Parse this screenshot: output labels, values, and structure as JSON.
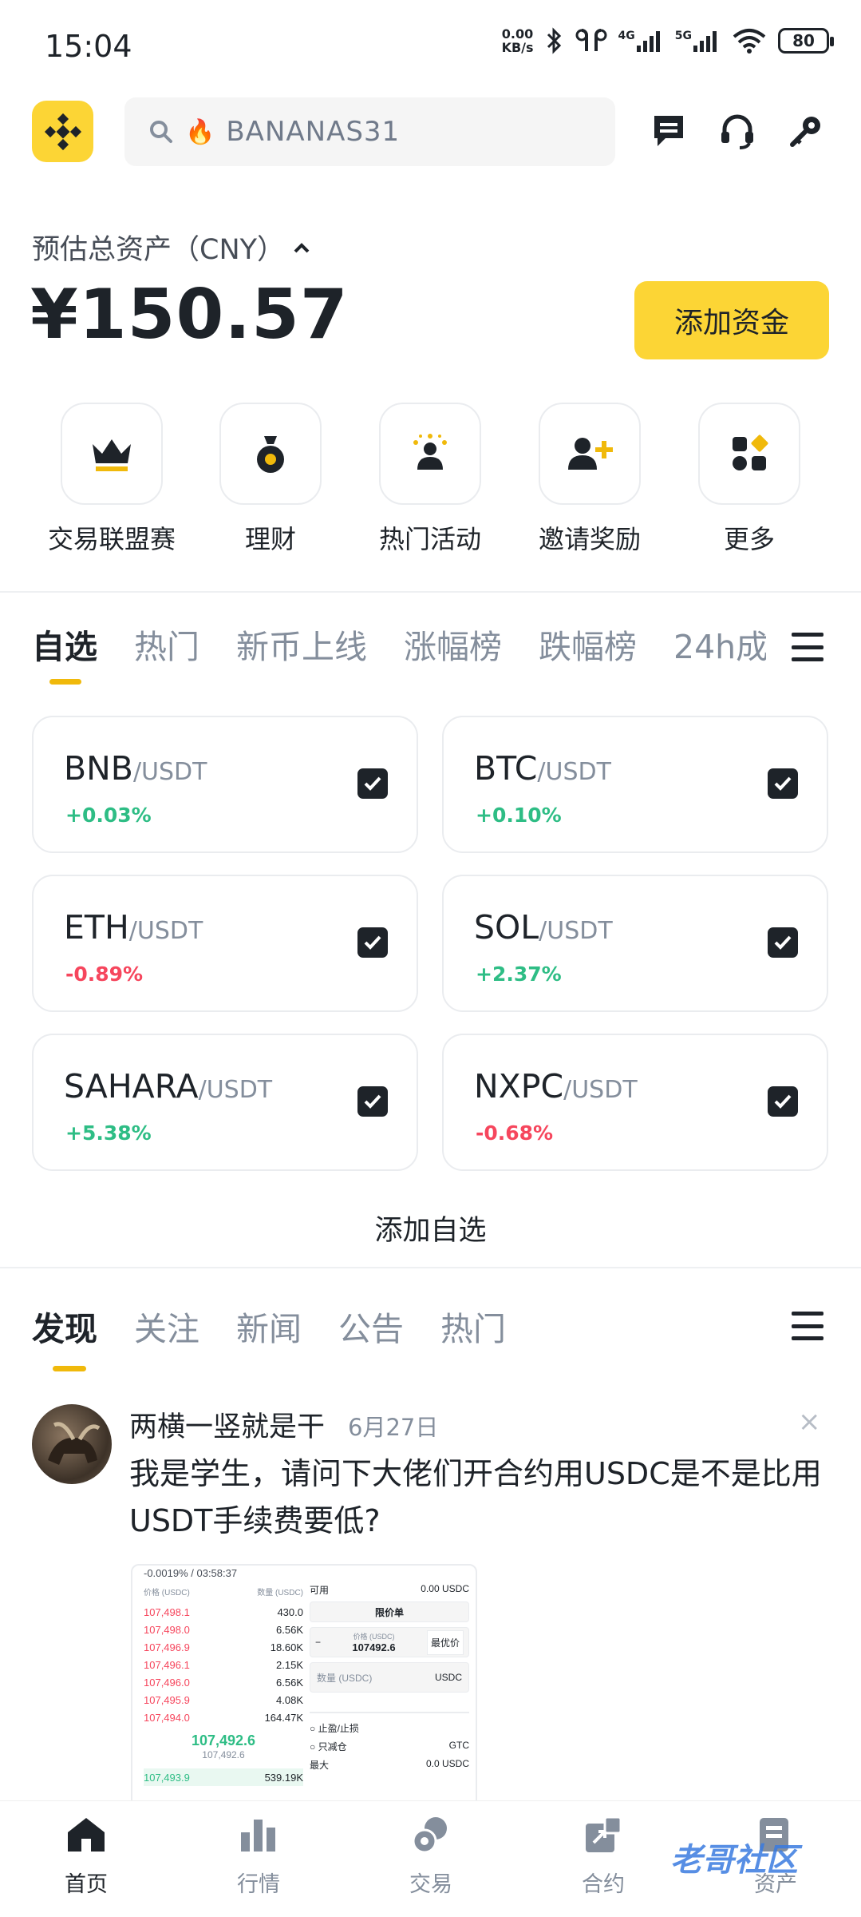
{
  "status_bar": {
    "time": "15:04",
    "net_speed": "0.00",
    "net_unit": "KB/s",
    "signal_1": "4G",
    "signal_2": "5G",
    "battery": "80"
  },
  "header": {
    "search_placeholder": "BANANAS31",
    "search_emoji": "🔥"
  },
  "assets": {
    "label": "预估总资产（CNY）",
    "value": "¥150.57",
    "add_funds": "添加资金"
  },
  "quick_actions": [
    {
      "label": "交易联盟赛",
      "icon": "crown-icon"
    },
    {
      "label": "理财",
      "icon": "money-bag-icon"
    },
    {
      "label": "热门活动",
      "icon": "celebration-icon"
    },
    {
      "label": "邀请奖励",
      "icon": "add-user-icon"
    },
    {
      "label": "更多",
      "icon": "grid-more-icon"
    }
  ],
  "watch_tabs": [
    "自选",
    "热门",
    "新币上线",
    "涨幅榜",
    "跌幅榜",
    "24h成"
  ],
  "watchlist": [
    {
      "base": "BNB",
      "quote": "/USDT",
      "change": "+0.03%",
      "dir": "up"
    },
    {
      "base": "BTC",
      "quote": "/USDT",
      "change": "+0.10%",
      "dir": "up"
    },
    {
      "base": "ETH",
      "quote": "/USDT",
      "change": "-0.89%",
      "dir": "down"
    },
    {
      "base": "SOL",
      "quote": "/USDT",
      "change": "+2.37%",
      "dir": "up"
    },
    {
      "base": "SAHARA",
      "quote": "/USDT",
      "change": "+5.38%",
      "dir": "up"
    },
    {
      "base": "NXPC",
      "quote": "/USDT",
      "change": "-0.68%",
      "dir": "down"
    }
  ],
  "add_watch": "添加自选",
  "feed_tabs": [
    "发现",
    "关注",
    "新闻",
    "公告",
    "热门"
  ],
  "post": {
    "user": "两横一竖就是干",
    "date": "6月27日",
    "close": "×",
    "text": "我是学生，请问下大佬们开合约用USDC是不是比用USDT手续费要低?",
    "embed": {
      "header": "-0.0019% / 03:58:37",
      "col_price": "价格 (USDC)",
      "col_qty": "数量 (USDC)",
      "asks": [
        {
          "price": "107,498.1",
          "qty": "430.0"
        },
        {
          "price": "107,498.0",
          "qty": "6.56K"
        },
        {
          "price": "107,496.9",
          "qty": "18.60K"
        },
        {
          "price": "107,496.1",
          "qty": "2.15K"
        },
        {
          "price": "107,496.0",
          "qty": "6.56K"
        },
        {
          "price": "107,495.9",
          "qty": "4.08K"
        },
        {
          "price": "107,494.0",
          "qty": "164.47K"
        }
      ],
      "last": "107,492.6",
      "mark": "107,492.6",
      "bid": {
        "price": "107,493.9",
        "qty": "539.19K"
      },
      "available_label": "可用",
      "available_value": "0.00 USDC",
      "order_type": "限价单",
      "price_label": "价格 (USDC)",
      "price_value": "107492.6",
      "best_price": "最优价",
      "qty_placeholder": "数量 (USDC)",
      "qty_unit": "USDC",
      "tp_sl": "止盈/止损",
      "reduce_only": "只减仓",
      "tif": "GTC",
      "max_label": "最大",
      "max_value": "0.0 USDC"
    }
  },
  "bottom_nav": [
    {
      "label": "首页",
      "icon": "home-icon",
      "active": true
    },
    {
      "label": "行情",
      "icon": "bar-chart-icon",
      "active": false
    },
    {
      "label": "交易",
      "icon": "trade-coins-icon",
      "active": false
    },
    {
      "label": "合约",
      "icon": "futures-icon",
      "active": false
    },
    {
      "label": "资产",
      "icon": "wallet-icon",
      "active": false
    }
  ],
  "watermark": "老哥社区",
  "colors": {
    "brand": "#fcd535",
    "up": "#2ebd85",
    "down": "#f6465d",
    "text": "#1e2329",
    "muted": "#848e9c"
  }
}
